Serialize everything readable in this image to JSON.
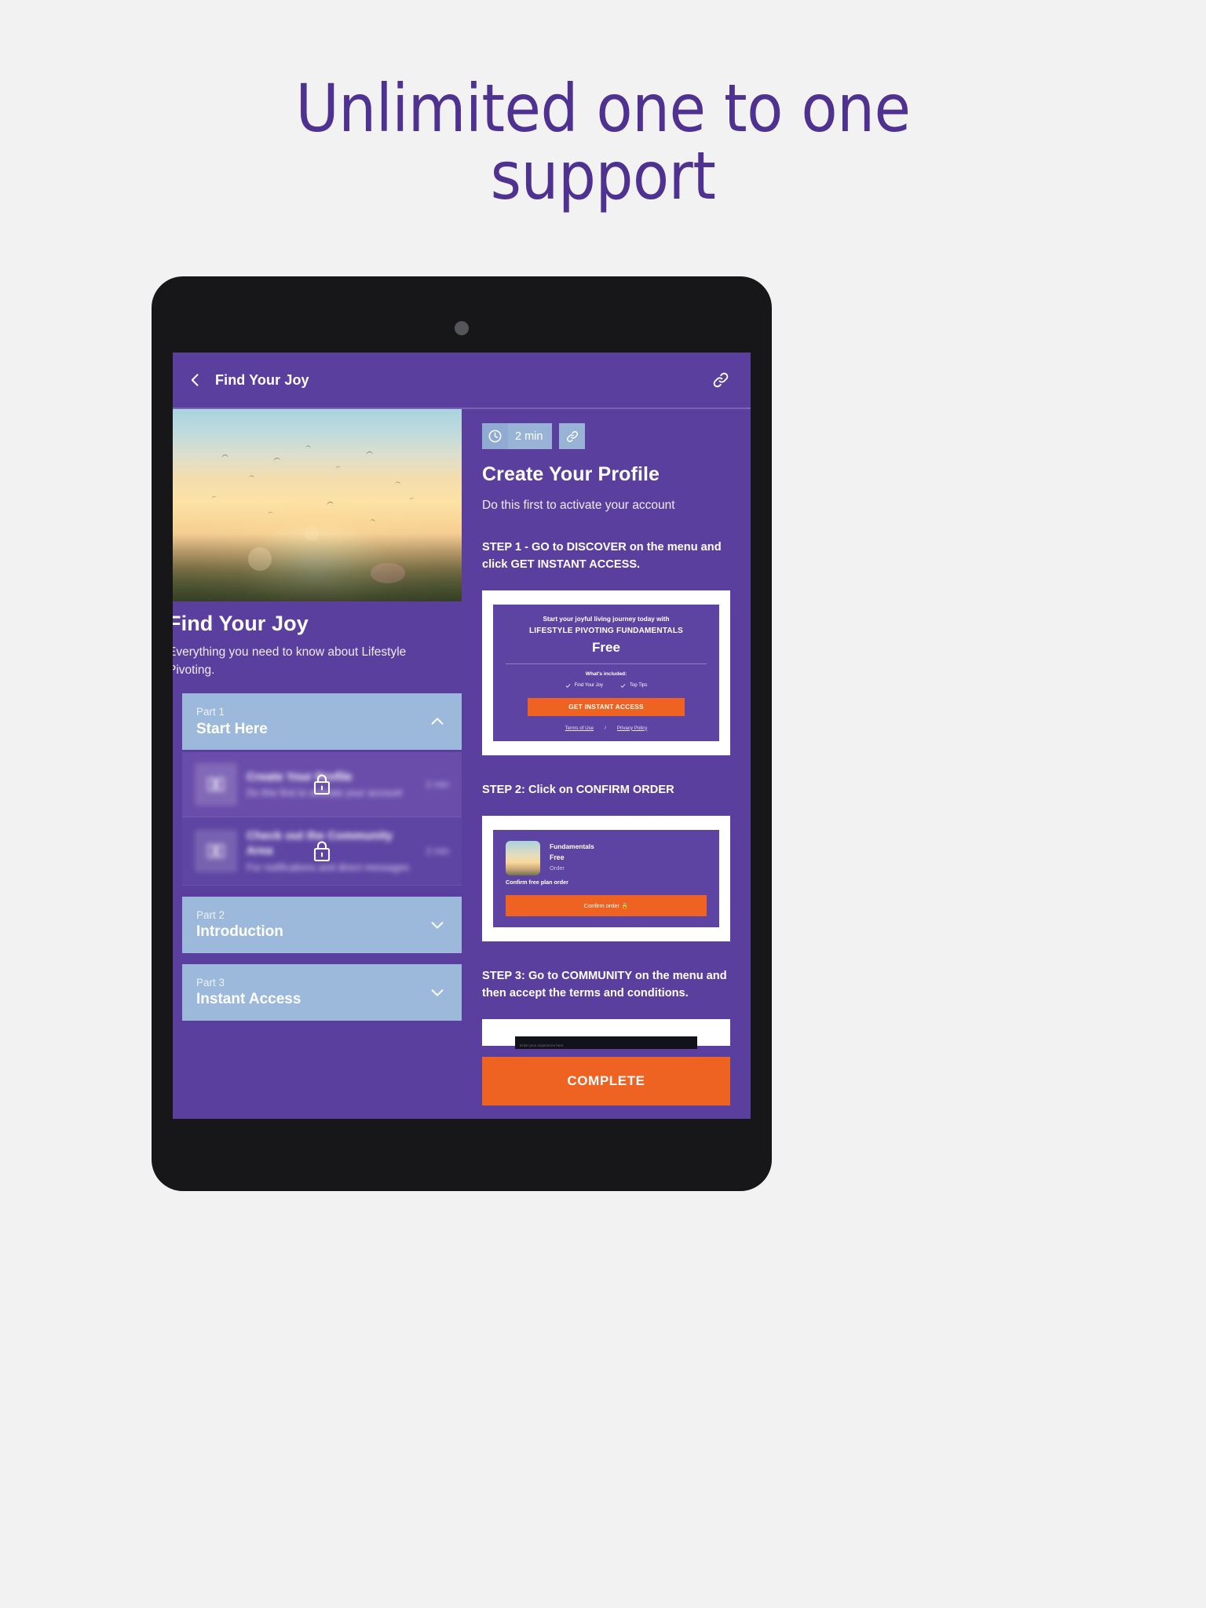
{
  "headline": {
    "line1": "Unlimited one to one",
    "line2": "support"
  },
  "colors": {
    "page_background": "#f2f2f3",
    "headline_purple": "#4f3191",
    "app_purple": "#5a3f9e",
    "section_blue": "#9cb9db",
    "badge_blue": "#98b3d6",
    "accent_orange": "#ef6322",
    "device_black": "#17171a"
  },
  "appbar": {
    "back_icon": "chevron-left-icon",
    "title": "Find Your Joy",
    "link_icon": "link-icon"
  },
  "left_pane": {
    "hero_image_alt": "sunset-meadow-photo",
    "course_title": "Find Your Joy",
    "course_subtitle": "Everything you need to know about Lifestyle Pivoting.",
    "sections": [
      {
        "part": "Part 1",
        "name": "Start Here",
        "chevron": "chevron-up-icon",
        "expanded": true,
        "lessons": [
          {
            "icon": "book-icon",
            "name": "Create Your Profile",
            "desc": "Do this first to activate your account",
            "duration": "2 min",
            "locked": true,
            "lock_icon": "lock-icon"
          },
          {
            "icon": "book-icon",
            "name": "Check out the Community Area",
            "desc": "For notifications and direct messages",
            "duration": "2 min",
            "locked": true,
            "lock_icon": "lock-icon"
          }
        ]
      },
      {
        "part": "Part 2",
        "name": "Introduction",
        "chevron": "chevron-down-icon",
        "expanded": false,
        "lessons": []
      },
      {
        "part": "Part 3",
        "name": "Instant Access",
        "chevron": "chevron-down-icon",
        "expanded": false,
        "lessons": []
      }
    ]
  },
  "right_pane": {
    "duration_badge": {
      "icon": "clock-icon",
      "label": "2 min"
    },
    "link_badge_icon": "link-icon",
    "title": "Create Your Profile",
    "subtitle": "Do this first to activate your account",
    "step1_text": "STEP 1 - GO to DISCOVER on the menu and click GET INSTANT ACCESS.",
    "screenshot1": {
      "tagline": "Start your joyful living journey today with",
      "product": "LIFESTYLE PIVOTING FUNDAMENTALS",
      "price": "Free",
      "included_label": "What's included:",
      "features": [
        "Find Your Joy",
        "Top Tips"
      ],
      "cta": "GET INSTANT ACCESS",
      "footer_links": [
        "Terms of Use",
        "Privacy Policy"
      ],
      "footer_separator": "/"
    },
    "step2_text": "STEP 2: Click on CONFIRM ORDER",
    "screenshot2": {
      "product": "Fundamentals",
      "price": "Free",
      "order_label": "Order",
      "confirm_label": "Confirm free plan order",
      "cta": "Confirm order",
      "cta_icon": "lock-icon"
    },
    "step3_text": "STEP 3: Go to COMMUNITY on the menu and then accept the terms and conditions.",
    "screenshot3": {
      "field_placeholder": "Enter your experience here"
    },
    "complete_button": "COMPLETE"
  }
}
